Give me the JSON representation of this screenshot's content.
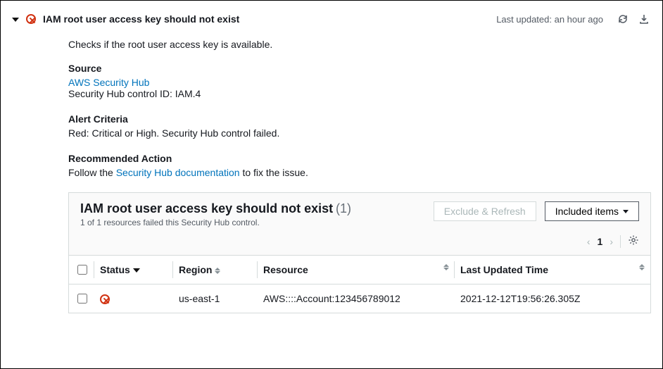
{
  "header": {
    "title": "IAM root user access key should not exist",
    "last_updated": "Last updated: an hour ago"
  },
  "details": {
    "description": "Checks if the root user access key is available.",
    "source_heading": "Source",
    "source_link": "AWS Security Hub",
    "source_control_id": "Security Hub control ID: IAM.4",
    "alert_heading": "Alert Criteria",
    "alert_text": "Red: Critical or High. Security Hub control failed.",
    "action_heading": "Recommended Action",
    "action_prefix": "Follow the ",
    "action_link": "Security Hub documentation",
    "action_suffix": " to fix the issue."
  },
  "panel": {
    "title": "IAM root user access key should not exist",
    "count": "(1)",
    "subtext": "1 of 1 resources failed this Security Hub control.",
    "exclude_btn": "Exclude & Refresh",
    "included_btn": "Included items",
    "page": "1"
  },
  "table": {
    "cols": {
      "status": "Status",
      "region": "Region",
      "resource": "Resource",
      "time": "Last Updated Time"
    },
    "rows": [
      {
        "status": "fail",
        "region": "us-east-1",
        "resource": "AWS::::Account:123456789012",
        "time": "2021-12-12T19:56:26.305Z"
      }
    ]
  }
}
